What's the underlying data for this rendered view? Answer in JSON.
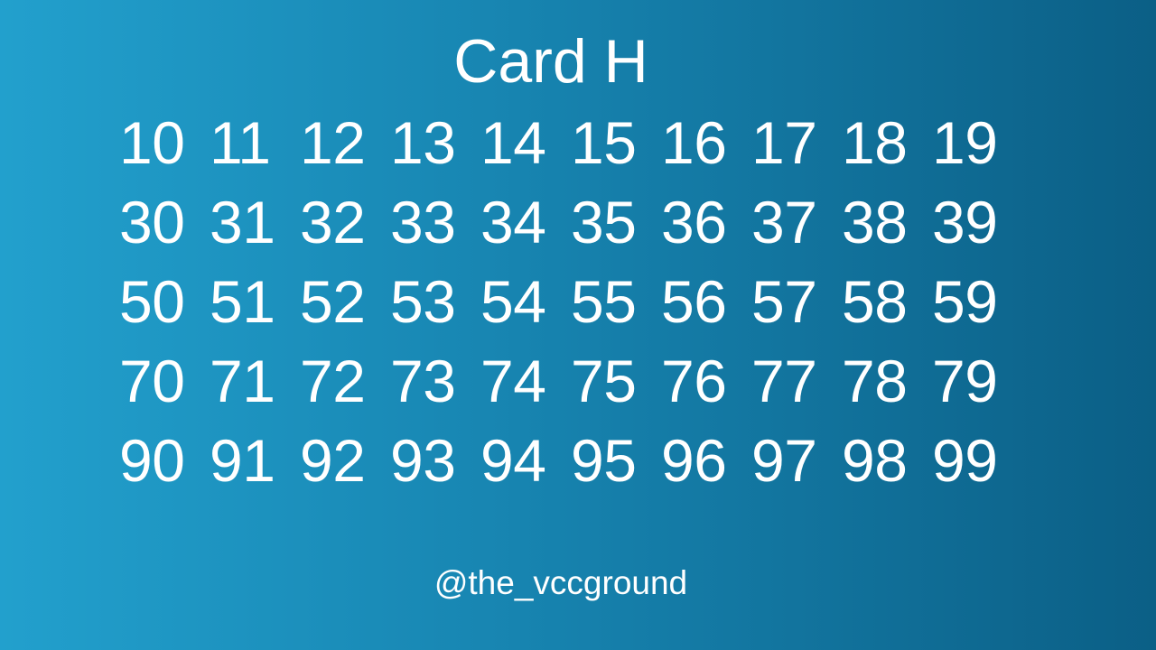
{
  "title": "Card H",
  "rows": [
    [
      "10",
      "11",
      "12",
      "13",
      "14",
      "15",
      "16",
      "17",
      "18",
      "19"
    ],
    [
      "30",
      "31",
      "32",
      "33",
      "34",
      "35",
      "36",
      "37",
      "38",
      "39"
    ],
    [
      "50",
      "51",
      "52",
      "53",
      "54",
      "55",
      "56",
      "57",
      "58",
      "59"
    ],
    [
      "70",
      "71",
      "72",
      "73",
      "74",
      "75",
      "76",
      "77",
      "78",
      "79"
    ],
    [
      "90",
      "91",
      "92",
      "93",
      "94",
      "95",
      "96",
      "97",
      "98",
      "99"
    ]
  ],
  "handle": "@the_vccground",
  "colors": {
    "background_left": "#22a0cd",
    "background_right": "#0b5f86",
    "text": "#ffffff"
  }
}
